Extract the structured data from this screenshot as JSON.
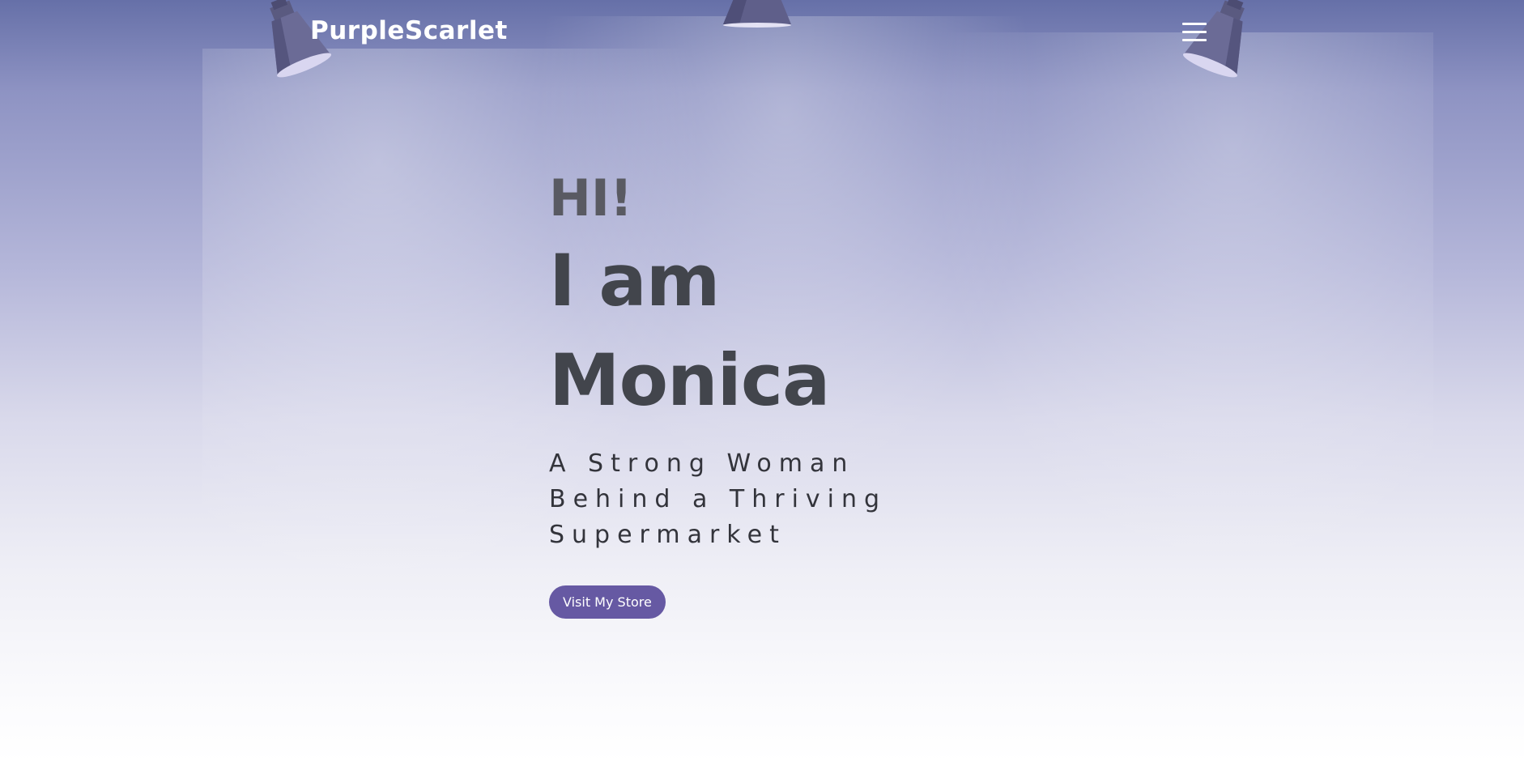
{
  "header": {
    "logo_text": "PurpleScarlet",
    "menu_icon": "hamburger-menu-icon"
  },
  "hero": {
    "greeting": "HI!",
    "intro_line1": "I am",
    "intro_line2": "Monica",
    "tagline": "A Strong Woman Behind a Thriving Supermarket",
    "cta_label": "Visit My Store"
  },
  "decor": {
    "lamp_icon": "spotlight-icon"
  },
  "colors": {
    "accent": "#6659a3",
    "heading": "#42454c",
    "background_top": "#6670a8",
    "background_bottom": "#ffffff"
  }
}
